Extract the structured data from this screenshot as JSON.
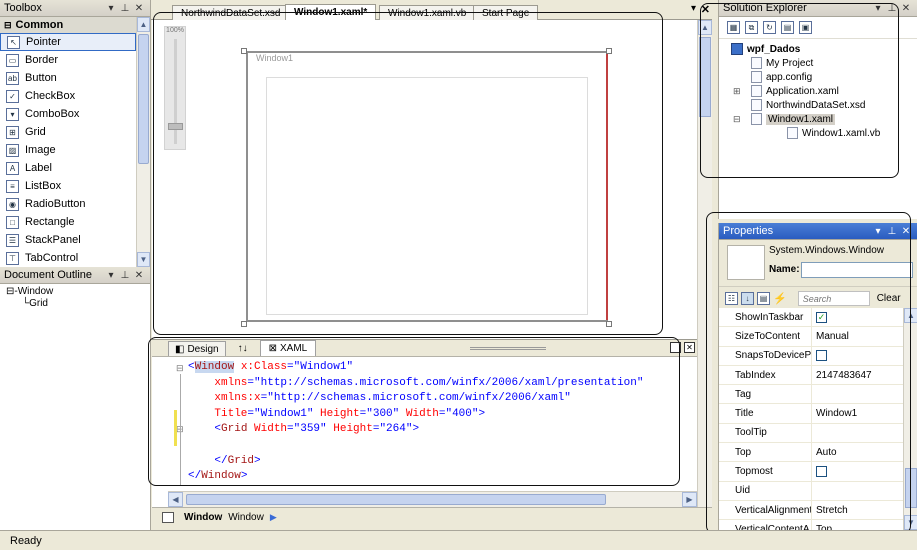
{
  "toolbox": {
    "title": "Toolbox",
    "section": "Common",
    "items": [
      {
        "label": "Pointer",
        "icon": "pointer-icon",
        "glyph": "↖"
      },
      {
        "label": "Border",
        "icon": "border-icon",
        "glyph": "▭"
      },
      {
        "label": "Button",
        "icon": "button-icon",
        "glyph": "ab"
      },
      {
        "label": "CheckBox",
        "icon": "checkbox-icon",
        "glyph": "✓"
      },
      {
        "label": "ComboBox",
        "icon": "combobox-icon",
        "glyph": "▾"
      },
      {
        "label": "Grid",
        "icon": "grid-icon",
        "glyph": "⊞"
      },
      {
        "label": "Image",
        "icon": "image-icon",
        "glyph": "▨"
      },
      {
        "label": "Label",
        "icon": "label-icon",
        "glyph": "A"
      },
      {
        "label": "ListBox",
        "icon": "listbox-icon",
        "glyph": "≡"
      },
      {
        "label": "RadioButton",
        "icon": "radiobutton-icon",
        "glyph": "◉"
      },
      {
        "label": "Rectangle",
        "icon": "rectangle-icon",
        "glyph": "□"
      },
      {
        "label": "StackPanel",
        "icon": "stackpanel-icon",
        "glyph": "☰"
      },
      {
        "label": "TabControl",
        "icon": "tabcontrol-icon",
        "glyph": "⊤"
      }
    ]
  },
  "document_outline": {
    "title": "Document Outline",
    "items": [
      "⊟-Window",
      "└Grid"
    ]
  },
  "tabs": [
    {
      "label": "NorthwindDataSet.xsd",
      "active": false
    },
    {
      "label": "Window1.xaml*",
      "active": true
    },
    {
      "label": "Window1.xaml.vb",
      "active": false
    },
    {
      "label": "Start Page",
      "active": false
    }
  ],
  "designer": {
    "zoom_top": "100%",
    "window_caption": "Window1"
  },
  "xaml_editor": {
    "tabs": [
      {
        "label": "Design",
        "glyph": "◧"
      },
      {
        "label": "↑↓",
        "glyph": ""
      },
      {
        "label": "XAML",
        "glyph": "⊠"
      }
    ],
    "lines": [
      [
        "<",
        "Window",
        " x:Class",
        "=\"Window1\""
      ],
      [
        "",
        "",
        "    xmlns",
        "=\"http://schemas.microsoft.com/winfx/2006/xaml/presentation\""
      ],
      [
        "",
        "",
        "    xmlns:x",
        "=\"http://schemas.microsoft.com/winfx/2006/xaml\""
      ],
      [
        "",
        "",
        "    Title",
        "=\"Window1\"",
        " Height",
        "=\"300\"",
        " Width",
        "=\"400\"",
        ">"
      ],
      [
        "    <",
        "Grid",
        " Width",
        "=\"359\"",
        " Height",
        "=\"264\"",
        ">"
      ],
      [
        ""
      ],
      [
        "    </",
        "Grid",
        ">"
      ],
      [
        "</",
        "Window",
        ">"
      ]
    ],
    "breadcrumb_bold": "Window",
    "breadcrumb_rest": "Window"
  },
  "solution_explorer": {
    "title": "Solution Explorer",
    "project": "wpf_Dados",
    "items": [
      {
        "label": "My Project",
        "indent": 1
      },
      {
        "label": "app.config",
        "indent": 1
      },
      {
        "label": "Application.xaml",
        "indent": 1,
        "expander": "⊞"
      },
      {
        "label": "NorthwindDataSet.xsd",
        "indent": 1
      },
      {
        "label": "Window1.xaml",
        "indent": 1,
        "expander": "⊟",
        "selected": true
      },
      {
        "label": "Window1.xaml.vb",
        "indent": 2
      }
    ]
  },
  "properties": {
    "title": "Properties",
    "type_name": "System.Windows.Window",
    "name_label": "Name:",
    "search_placeholder": "Search",
    "clear_label": "Clear",
    "rows": [
      {
        "name": "ShowInTaskbar",
        "value": "",
        "check": true
      },
      {
        "name": "SizeToContent",
        "value": "Manual"
      },
      {
        "name": "SnapsToDevicePi...",
        "value": "",
        "check": false
      },
      {
        "name": "TabIndex",
        "value": "2147483647"
      },
      {
        "name": "Tag",
        "value": ""
      },
      {
        "name": "Title",
        "value": "Window1"
      },
      {
        "name": "ToolTip",
        "value": ""
      },
      {
        "name": "Top",
        "value": "Auto"
      },
      {
        "name": "Topmost",
        "value": "",
        "check": false
      },
      {
        "name": "Uid",
        "value": ""
      },
      {
        "name": "VerticalAlignment",
        "value": "Stretch"
      },
      {
        "name": "VerticalContentA...",
        "value": "Top"
      }
    ]
  },
  "status_bar": {
    "text": "Ready"
  }
}
